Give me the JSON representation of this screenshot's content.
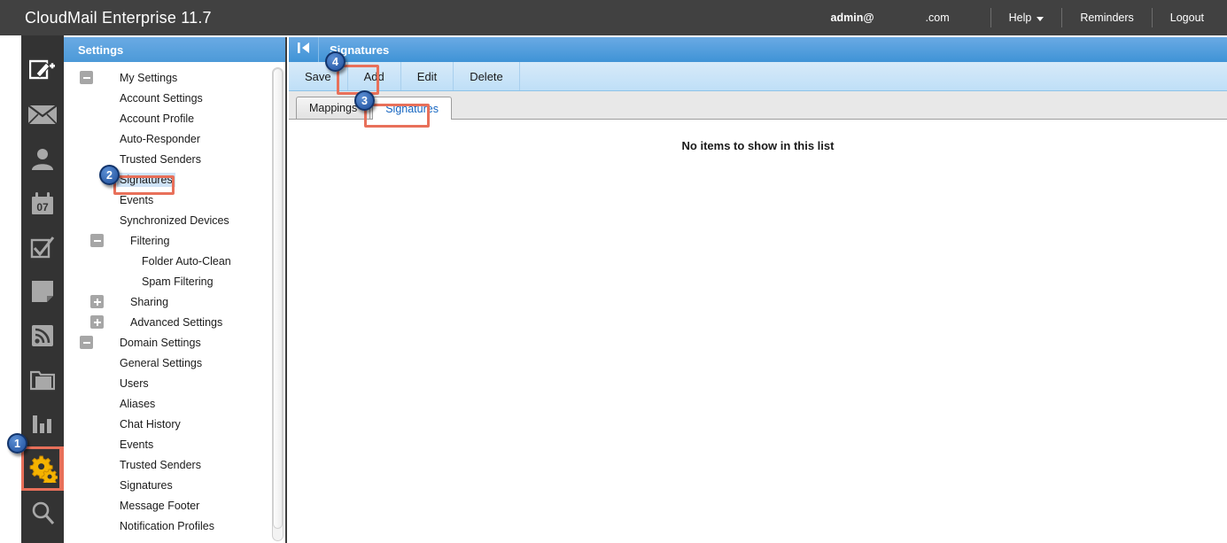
{
  "header": {
    "brand": "CloudMail Enterprise 11.7",
    "account": "admin@",
    "domain": ".com",
    "help": "Help",
    "reminders": "Reminders",
    "logout": "Logout"
  },
  "rail": {
    "items": [
      {
        "name": "compose-icon",
        "title": "Compose"
      },
      {
        "name": "mail-icon",
        "title": "Mail"
      },
      {
        "name": "contacts-icon",
        "title": "Contacts"
      },
      {
        "name": "calendar-icon",
        "title": "Calendar",
        "day": "07"
      },
      {
        "name": "tasks-icon",
        "title": "Tasks"
      },
      {
        "name": "notes-icon",
        "title": "Notes"
      },
      {
        "name": "rss-icon",
        "title": "RSS Feeds"
      },
      {
        "name": "folders-icon",
        "title": "File Storage"
      },
      {
        "name": "reports-icon",
        "title": "Reports"
      },
      {
        "name": "settings-gear-icon",
        "title": "Settings"
      },
      {
        "name": "search-icon",
        "title": "Search"
      }
    ]
  },
  "sidebar": {
    "title": "Settings",
    "items": [
      {
        "label": "My Settings",
        "level": "lvl0",
        "toggle": "minus"
      },
      {
        "label": "Account Settings",
        "level": "lvl1",
        "toggle": "none"
      },
      {
        "label": "Account Profile",
        "level": "lvl1",
        "toggle": "none"
      },
      {
        "label": "Auto-Responder",
        "level": "lvl1",
        "toggle": "none"
      },
      {
        "label": "Trusted Senders",
        "level": "lvl1",
        "toggle": "none"
      },
      {
        "label": "Signatures",
        "level": "lvl1",
        "toggle": "none",
        "selected": true
      },
      {
        "label": "Events",
        "level": "lvl1",
        "toggle": "none"
      },
      {
        "label": "Synchronized Devices",
        "level": "lvl1",
        "toggle": "none"
      },
      {
        "label": "Filtering",
        "level": "lvl1b",
        "toggle": "minus"
      },
      {
        "label": "Folder Auto-Clean",
        "level": "lvl2",
        "toggle": "none"
      },
      {
        "label": "Spam Filtering",
        "level": "lvl2",
        "toggle": "none"
      },
      {
        "label": "Sharing",
        "level": "lvl1b",
        "toggle": "plus"
      },
      {
        "label": "Advanced Settings",
        "level": "lvl1b",
        "toggle": "plus"
      },
      {
        "label": "Domain Settings",
        "level": "lvl0",
        "toggle": "minus"
      },
      {
        "label": "General Settings",
        "level": "lvl1",
        "toggle": "none"
      },
      {
        "label": "Users",
        "level": "lvl1",
        "toggle": "none"
      },
      {
        "label": "Aliases",
        "level": "lvl1",
        "toggle": "none"
      },
      {
        "label": "Chat History",
        "level": "lvl1",
        "toggle": "none"
      },
      {
        "label": "Events",
        "level": "lvl1",
        "toggle": "none"
      },
      {
        "label": "Trusted Senders",
        "level": "lvl1",
        "toggle": "none"
      },
      {
        "label": "Signatures",
        "level": "lvl1",
        "toggle": "none"
      },
      {
        "label": "Message Footer",
        "level": "lvl1",
        "toggle": "none"
      },
      {
        "label": "Notification Profiles",
        "level": "lvl1",
        "toggle": "none"
      }
    ]
  },
  "main": {
    "title": "Signatures",
    "toolbar": [
      {
        "label": "Save"
      },
      {
        "label": "Add"
      },
      {
        "label": "Edit"
      },
      {
        "label": "Delete"
      }
    ],
    "tabs": [
      {
        "label": "Mappings",
        "active": false
      },
      {
        "label": "Signatures",
        "active": true
      }
    ],
    "empty_message": "No items to show in this list"
  },
  "markers": [
    {
      "badge": "1",
      "target": "settings-gear-icon"
    },
    {
      "badge": "2",
      "target": "sidebar-item-signatures"
    },
    {
      "badge": "3",
      "target": "tab-signatures"
    },
    {
      "badge": "4",
      "target": "toolbar-add-button"
    }
  ],
  "colors": {
    "header_bg": "#414141",
    "rail_bg": "#333333",
    "panel_title": "#4c9ad8",
    "toolbar": "#bfdff7",
    "marker": "#e8705a",
    "badge": "#1f4f9c",
    "gear": "#f5b300",
    "selected_row": "#cfe3f7",
    "active_tab_text": "#1565c0"
  }
}
